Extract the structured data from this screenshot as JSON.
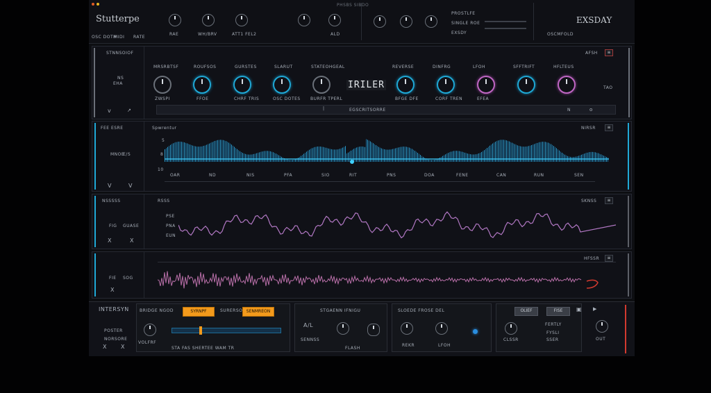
{
  "top_bar": {
    "title": "Stutterpe",
    "sub_labels": [
      "OSC DOTH",
      "MIDI",
      "RATE"
    ],
    "window_label": "PHSBS SIBDO",
    "knob_labels": [
      "RAE",
      "WH/BRV",
      "ATT1 FEL2",
      "ALD"
    ],
    "right_labels": [
      "PROSTLFE",
      "SINGLE ROE",
      "EXSDY"
    ],
    "brand": "EXSDAY",
    "brand_sub": "OSCMFOLD"
  },
  "eq_panel": {
    "header": "STNNSOIOF",
    "left_labels": [
      "NS",
      "EHA"
    ],
    "knob_tags": [
      "MRSRBTSF",
      "ROUFSOS",
      "GURSTES",
      "SLARUT",
      "STATEOHGEAL",
      "REVERSE",
      "DINFRG",
      "LFOH",
      "SFFTRIFT",
      "HFLTEUS"
    ],
    "knob_labels": [
      "ZWSPI",
      "FFOE",
      "CHRF TRIS",
      "OSC DOTES",
      "BURFR TPERL",
      "BFGE DFE",
      "CORF TREN",
      "EFEA"
    ],
    "display": "IRILER",
    "right_tag": "AFSH",
    "side": "TAO",
    "center_label": "EGSCRITSORRE"
  },
  "wave_panel": {
    "header": "Spwrentur",
    "left_header": "FEE ESRE",
    "left_labels": [
      "MNOE",
      "E/S"
    ],
    "y_labels": [
      "5",
      "8",
      "10"
    ],
    "ticks": [
      "OAR",
      "ND",
      "NIS",
      "PFA",
      "SIO",
      "RIT",
      "PNS",
      "DOA",
      "FENE",
      "CAN",
      "RUN",
      "SEN"
    ],
    "tag": "NIRSR"
  },
  "lfo_panel": {
    "header": "RSSS",
    "left_header": "NSSSSS",
    "left_labels": [
      "FIG",
      "GUASE"
    ],
    "y_labels": [
      "PSE",
      "PNA",
      "EUN"
    ],
    "tag": "SKNSS"
  },
  "noise_panel": {
    "left_labels": [
      "FIE",
      "SOG"
    ],
    "tag": "HFSSR"
  },
  "bottom": {
    "title": "INTERSYN",
    "left_labels": [
      "POSTER",
      "NORSORE"
    ],
    "tabs": [
      "BRIDGE NGOD",
      "SURERSO",
      "VOLFRF"
    ],
    "orange_1": "SYRNPF",
    "orange_2": "SENMREON",
    "slider_caption": "STA FAS SHERTEE WAM TR",
    "sec2_title": "STGAENN IFNIGU",
    "sec2_labels": [
      "SENNSS",
      "FLASH"
    ],
    "sec3_title": "SLOEDE FROSE DEL",
    "sec3_labels": [
      "REKR",
      "LFOH"
    ],
    "sec4_btns": [
      "OLIEF",
      "FISE"
    ],
    "sec4_labels": [
      "FERTLY",
      "FYSLI",
      "CLSSR",
      "SSER"
    ]
  },
  "colors": {
    "cyan": "#1fa9d6",
    "pink": "#c067c4",
    "orange": "#f39a1c",
    "red": "#d23a2f"
  }
}
